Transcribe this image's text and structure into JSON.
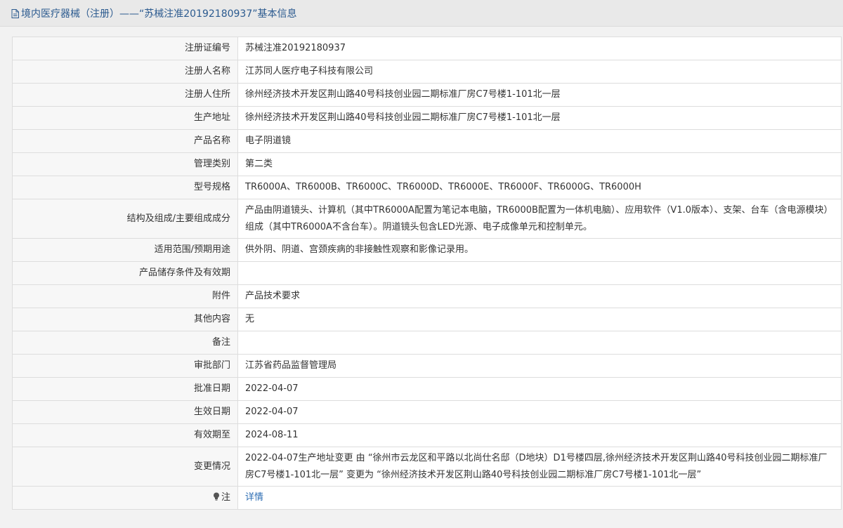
{
  "header": {
    "title": "境内医疗器械（注册）——“苏械注准20192180937”基本信息"
  },
  "rows": [
    {
      "label": "注册证编号",
      "value": "苏械注准20192180937"
    },
    {
      "label": "注册人名称",
      "value": "江苏同人医疗电子科技有限公司"
    },
    {
      "label": "注册人住所",
      "value": "徐州经济技术开发区荆山路40号科技创业园二期标准厂房C7号楼1-101北一层"
    },
    {
      "label": "生产地址",
      "value": "徐州经济技术开发区荆山路40号科技创业园二期标准厂房C7号楼1-101北一层"
    },
    {
      "label": "产品名称",
      "value": "电子阴道镜"
    },
    {
      "label": "管理类别",
      "value": "第二类"
    },
    {
      "label": "型号规格",
      "value": "TR6000A、TR6000B、TR6000C、TR6000D、TR6000E、TR6000F、TR6000G、TR6000H"
    },
    {
      "label": "结构及组成/主要组成成分",
      "value": "产品由阴道镜头、计算机（其中TR6000A配置为笔记本电脑，TR6000B配置为一体机电脑）、应用软件（V1.0版本）、支架、台车（含电源模块）组成（其中TR6000A不含台车）。阴道镜头包含LED光源、电子成像单元和控制单元。"
    },
    {
      "label": "适用范围/预期用途",
      "value": "供外阴、阴道、宫颈疾病的非接触性观察和影像记录用。"
    },
    {
      "label": "产品储存条件及有效期",
      "value": ""
    },
    {
      "label": "附件",
      "value": "产品技术要求"
    },
    {
      "label": "其他内容",
      "value": "无"
    },
    {
      "label": "备注",
      "value": ""
    },
    {
      "label": "审批部门",
      "value": "江苏省药品监督管理局"
    },
    {
      "label": "批准日期",
      "value": "2022-04-07"
    },
    {
      "label": "生效日期",
      "value": "2022-04-07"
    },
    {
      "label": "有效期至",
      "value": "2024-08-11"
    },
    {
      "label": "变更情况",
      "value": "2022-04-07生产地址变更 由 “徐州市云龙区和平路以北尚仕名邸（D地块）D1号楼四层,徐州经济技术开发区荆山路40号科技创业园二期标准厂房C7号楼1-101北一层” 变更为 “徐州经济技术开发区荆山路40号科技创业园二期标准厂房C7号楼1-101北一层”"
    }
  ],
  "note": {
    "label": "注",
    "link_text": "详情",
    "icon": "lightbulb-icon"
  },
  "colors": {
    "title_text": "#2b5a8f",
    "link": "#2b6cb3",
    "label_bg": "#f7f7f7",
    "border": "#dddddd"
  }
}
